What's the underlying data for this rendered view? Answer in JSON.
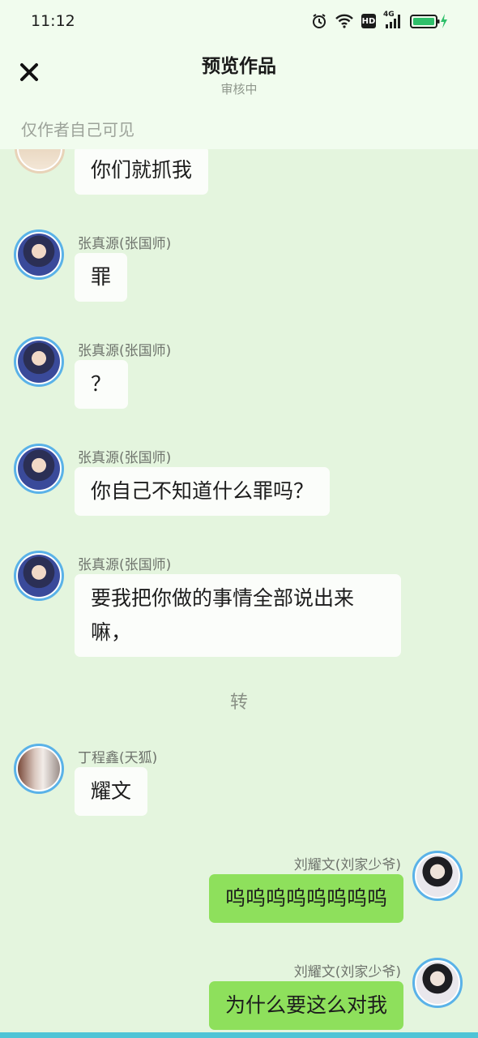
{
  "status": {
    "time": "11:12",
    "icons": [
      "alarm-icon",
      "wifi-icon",
      "hd-icon",
      "signal-4g-icon",
      "battery-charging-icon"
    ],
    "network_label": "4G",
    "hd_label": "HD"
  },
  "header": {
    "title": "预览作品",
    "subtitle": "审核中",
    "close_icon": "close-icon"
  },
  "notice": "仅作者自己可见",
  "messages": [
    {
      "side": "left",
      "sender": "",
      "text": "你们就抓我"
    },
    {
      "side": "left",
      "sender": "张真源(张国师)",
      "text": "罪"
    },
    {
      "side": "left",
      "sender": "张真源(张国师)",
      "text": "？"
    },
    {
      "side": "left",
      "sender": "张真源(张国师)",
      "text": "你自己不知道什么罪吗？"
    },
    {
      "side": "left",
      "sender": "张真源(张国师)",
      "text_line1": "要我把你做的事情全部说出来",
      "text_line2": "嘛，"
    },
    {
      "side": "left",
      "sender": "丁程鑫(天狐)",
      "text": "耀文"
    },
    {
      "side": "right",
      "sender": "刘耀文(刘家少爷)",
      "text": "呜呜呜呜呜呜呜呜"
    },
    {
      "side": "right",
      "sender": "刘耀文(刘家少爷)",
      "text": "为什么要这么对我"
    }
  ],
  "divider": "转",
  "colors": {
    "chat_background": "#e4f5de",
    "header_background": "#f1fcee",
    "bubble_left": "#fbfdfa",
    "bubble_right": "#8ee05c",
    "avatar_ring": "#5ab2e8"
  }
}
